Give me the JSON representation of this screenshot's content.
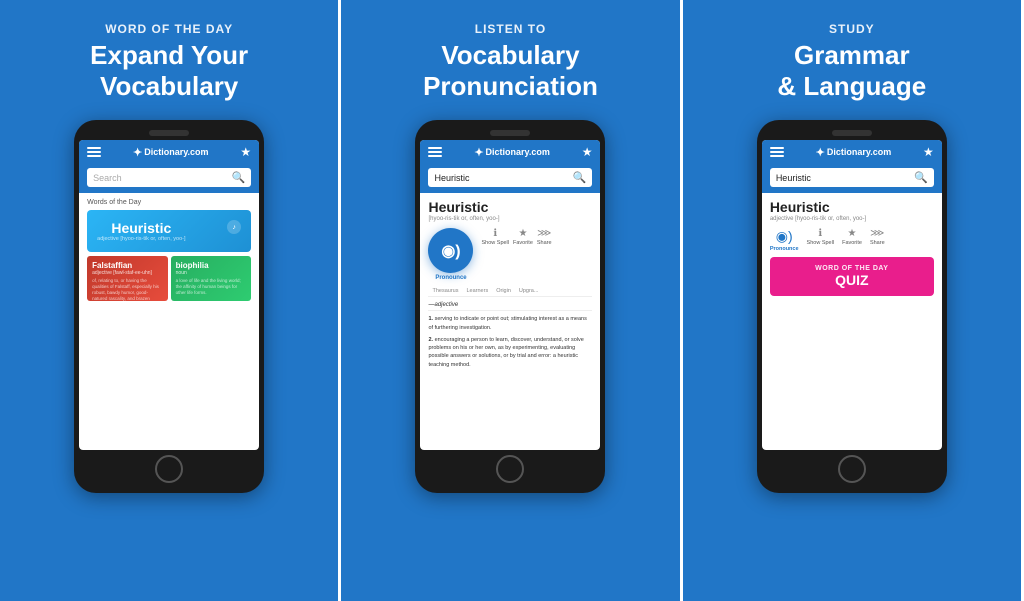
{
  "panels": [
    {
      "id": "word-of-day",
      "subtitle": "WORD OF THE DAY",
      "title": "Expand Your\nVocabulary",
      "phone": {
        "search_placeholder": "Search",
        "wotd_label": "Words of the Day",
        "featured_word": "Heuristic",
        "featured_pos": "adjective [hyoo-ris-tik or, often, yoo-]",
        "grid_words": [
          {
            "word": "Falstaffian",
            "pos": "adjective [fawl-staf-ee-uhn]",
            "desc": "of, relating to, or having the qualities of Falstaff, especially his robust, bawdy humor, good-natured rascality, and brazen braggadocio.",
            "color": "red"
          },
          {
            "word": "biophilia",
            "pos": "noun",
            "desc": "a love of life and the living world; the affinity of human beings for other life forms.",
            "color": "green"
          }
        ]
      }
    },
    {
      "id": "pronunciation",
      "subtitle": "LISTEN TO",
      "title": "Vocabulary\nPronunciation",
      "phone": {
        "search_value": "Heuristic",
        "dict_word": "Heuristic",
        "dict_pron": "[hyoo-ris-tik or, often, yoo-]",
        "pronounce_label": "Pronounce",
        "actions": [
          "Show Spell",
          "Favorite",
          "Share"
        ],
        "tabs": [
          "Thesaurus",
          "Learners",
          "Origin",
          "Upgra..."
        ],
        "section": "—adjective",
        "definitions": [
          "serving to indicate or point out; stimulating interest as a means of furthering investigation.",
          "encouraging a person to learn, discover, understand, or solve problems on his or her own, as by experimenting, evaluating possible answers or solutions, or by trial and error: a heuristic teaching method."
        ]
      }
    },
    {
      "id": "study",
      "subtitle": "STUDY",
      "title": "Grammar\n& Language",
      "phone": {
        "search_value": "Heuristic",
        "dict_word": "Heuristic",
        "dict_pron": "adjective [hyoo-ris-tik or, often, yoo-]",
        "pronounce_label": "Pronounce",
        "actions": [
          "Show Spell",
          "Favorite",
          "Share"
        ],
        "quiz_label": "WORD OF THE DAY",
        "quiz_title": "QUIZ"
      }
    }
  ],
  "logo": "Dictionary.com",
  "icons": {
    "hamburger": "☰",
    "star": "★",
    "search": "🔍",
    "sound": "◉)",
    "show_spell": "ℹ",
    "favorite": "★",
    "share": "⋙"
  }
}
